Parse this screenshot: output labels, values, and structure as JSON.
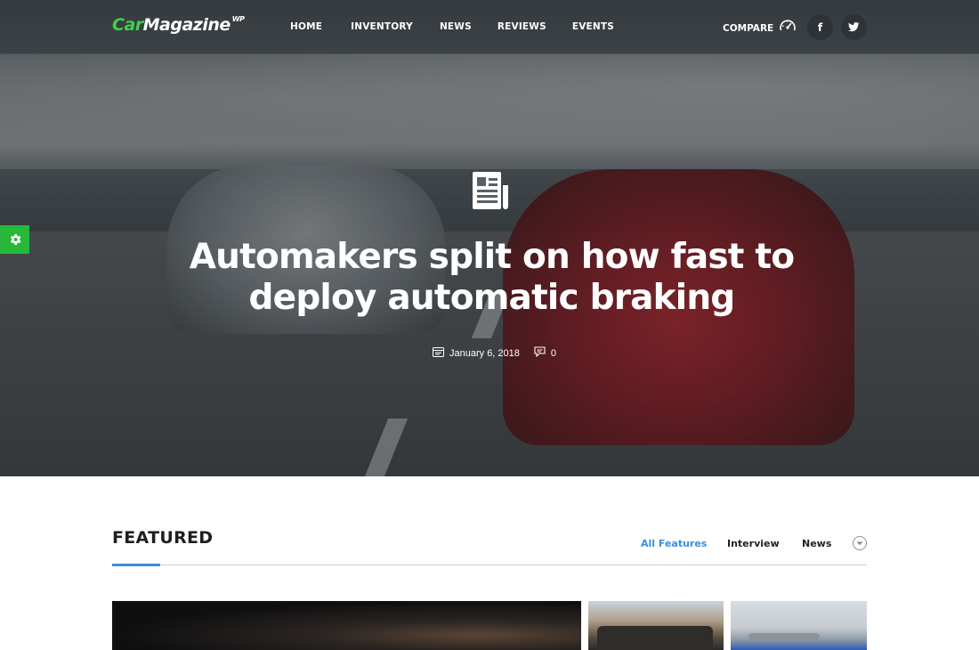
{
  "header": {
    "logo": {
      "brand_part1": "Car",
      "brand_part2": "Magazine",
      "superscript": "WP"
    },
    "menu": [
      {
        "label": "HOME"
      },
      {
        "label": "INVENTORY"
      },
      {
        "label": "NEWS"
      },
      {
        "label": "REVIEWS"
      },
      {
        "label": "EVENTS"
      }
    ],
    "compare_label": "COMPARE",
    "compare_icon": "speedometer-icon",
    "social": [
      {
        "icon": "facebook-icon",
        "glyph": "f"
      },
      {
        "icon": "twitter-icon",
        "glyph": "t"
      }
    ]
  },
  "hero": {
    "category_icon": "newspaper-icon",
    "title": "Automakers split on how fast to deploy automatic braking",
    "date": "January 6, 2018",
    "comment_count": "0"
  },
  "settings_icon": "gear-icon",
  "featured": {
    "title": "FEATURED",
    "tabs": [
      {
        "label": "All Features",
        "active": true
      },
      {
        "label": "Interview",
        "active": false
      },
      {
        "label": "News",
        "active": false
      }
    ],
    "more_icon": "chevron-down-icon"
  },
  "colors": {
    "brand_green": "#3fd14b",
    "accent_blue": "#3a8de0",
    "settings_green": "#27b83a"
  }
}
